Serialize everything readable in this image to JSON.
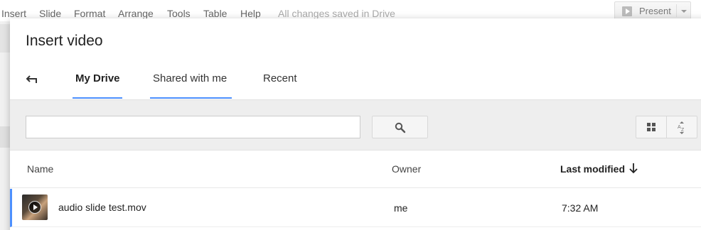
{
  "menubar": {
    "items": [
      "Insert",
      "Slide",
      "Format",
      "Arrange",
      "Tools",
      "Table",
      "Help"
    ],
    "status": "All changes saved in Drive",
    "present_label": "Present"
  },
  "dialog": {
    "title": "Insert video",
    "tabs": [
      {
        "label": "My Drive",
        "active": true
      },
      {
        "label": "Shared with me",
        "active": false
      },
      {
        "label": "Recent",
        "active": false
      }
    ],
    "search": {
      "value": "",
      "placeholder": ""
    },
    "table": {
      "columns": {
        "name": "Name",
        "owner": "Owner",
        "modified": "Last modified"
      },
      "sort": "Last modified, descending",
      "rows": [
        {
          "name": "audio slide test.mov",
          "owner": "me",
          "modified": "7:32 AM",
          "type": "video"
        }
      ]
    }
  },
  "colors": {
    "accent": "#4d90fe",
    "toolbar_bg": "#eeeeee"
  },
  "icons": [
    "back-arrow-icon",
    "search-icon",
    "grid-view-icon",
    "sort-az-icon",
    "arrow-down-icon",
    "play-icon"
  ]
}
